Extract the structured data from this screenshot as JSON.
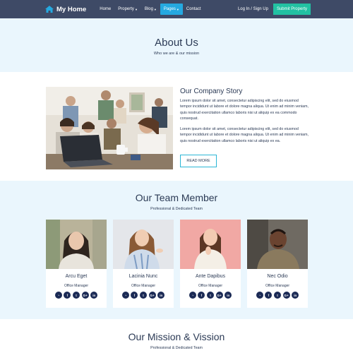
{
  "nav": {
    "brand": "My Home",
    "items": [
      {
        "label": "Home",
        "caret": false
      },
      {
        "label": "Property",
        "caret": true
      },
      {
        "label": "Blog",
        "caret": true
      },
      {
        "label": "Pages",
        "caret": true,
        "active": true
      },
      {
        "label": "Contact",
        "caret": false
      }
    ],
    "login": "Log In / Sign Up",
    "submit": "Submit Property"
  },
  "hero": {
    "title": "About Us",
    "subtitle": "Who we are & our mission"
  },
  "story": {
    "heading": "Our Company Story",
    "paragraph1": "Lorem ipsum dolor sit amet, consectetur adipiscing elit, sed do eiusmod tempor incididunt ut labore et dolore magna aliqua. Ut enim ad minim veniam, quis nostrud exercitation ullamco laboris nisi ut aliquip ex ea commodo consequat.",
    "paragraph2": "Lorem ipsum dolor sit amet, consectetur adipiscing elit, sed do eiusmod tempor incididunt ut labore et dolore magna aliqua. Ut enim ad minim veniam, quis nostrud exercitation ullamco laboris nisi ut aliquip ex ea.",
    "read_more": "READ MORE"
  },
  "team": {
    "title": "Our Team Member",
    "subtitle": "Professional & Dedicated Team",
    "members": [
      {
        "name": "Arcu Eget",
        "role": "Office Manager"
      },
      {
        "name": "Lacinia Nunc",
        "role": "Office Manager"
      },
      {
        "name": "Ante Dapibus",
        "role": "Office Manager"
      },
      {
        "name": "Nec Odio",
        "role": "Office Manager"
      }
    ],
    "social_icons": [
      "rss-icon",
      "facebook-icon",
      "twitter-icon",
      "google-plus-icon",
      "linkedin-icon"
    ],
    "social_glyphs": [
      "◔",
      "f",
      "t",
      "G+",
      "in"
    ]
  },
  "mission": {
    "title": "Our Mission & Vission",
    "subtitle": "Professional & Dedicated Team"
  },
  "colors": {
    "nav_bg": "#3e4a66",
    "accent": "#25a9e0",
    "submit": "#22c1a2",
    "section_bg": "#eaf6fd",
    "social_bg": "#1b2a55"
  }
}
